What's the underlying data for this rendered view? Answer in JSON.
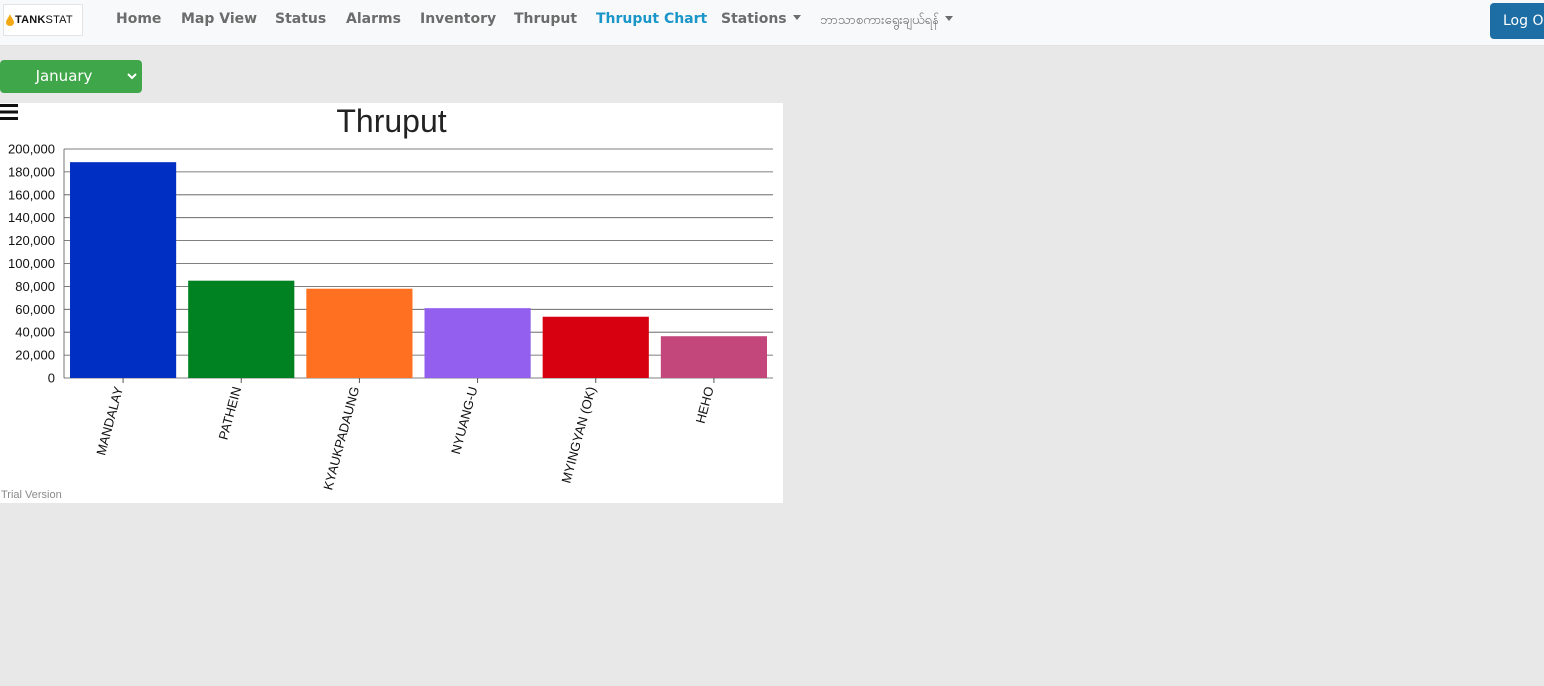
{
  "brand": {
    "name_bold": "TANK",
    "name_rest": "STAT"
  },
  "nav": {
    "home": "Home",
    "map_view": "Map View",
    "status": "Status",
    "alarms": "Alarms",
    "inventory": "Inventory",
    "thruput": "Thruput",
    "thruput_chart": "Thruput Chart",
    "stations": "Stations",
    "language": "ဘာသာစကားရွေးချယ်ရန်",
    "logout": "Log Out"
  },
  "month_select": {
    "selected": "January"
  },
  "colors": {
    "nav_active": "#1a96c9",
    "logout": "#1c6ea4",
    "select_bg": "#3fa649"
  },
  "chart_data": {
    "type": "bar",
    "title": "Thruput",
    "categories": [
      "MANDALAY",
      "PATHEIN",
      "KYAUKPADAUNG",
      "NYUANG-U",
      "MYINGYAN (OK)",
      "HEHO"
    ],
    "values": [
      188500,
      85000,
      78000,
      61000,
      53500,
      36500
    ],
    "colors": [
      "#002fc4",
      "#008222",
      "#ff7020",
      "#935fee",
      "#d60010",
      "#c3477a"
    ],
    "ylim": [
      0,
      200000
    ],
    "yticks": [
      "0",
      "20,000",
      "40,000",
      "60,000",
      "80,000",
      "100,000",
      "120,000",
      "140,000",
      "160,000",
      "180,000",
      "200,000"
    ],
    "grid": true,
    "footer": "Trial Version"
  }
}
